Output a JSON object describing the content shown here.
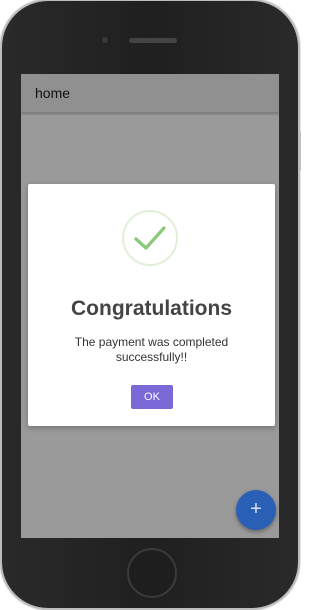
{
  "device": {
    "type": "smartphone"
  },
  "app_bar": {
    "title": "home"
  },
  "dialog": {
    "icon": "check-circle-icon",
    "title": "Congratulations",
    "message": "The payment was completed successfully!!",
    "ok_label": "OK"
  },
  "fab": {
    "icon": "plus-icon",
    "symbol": "+"
  },
  "colors": {
    "overlay": "#9a9a9a",
    "app_bar": "#909090",
    "dialog_bg": "#ffffff",
    "check": "#8bc97a",
    "ok_button": "#7a68d6",
    "fab": "#2a5fb6",
    "phone_body": "#222222"
  }
}
